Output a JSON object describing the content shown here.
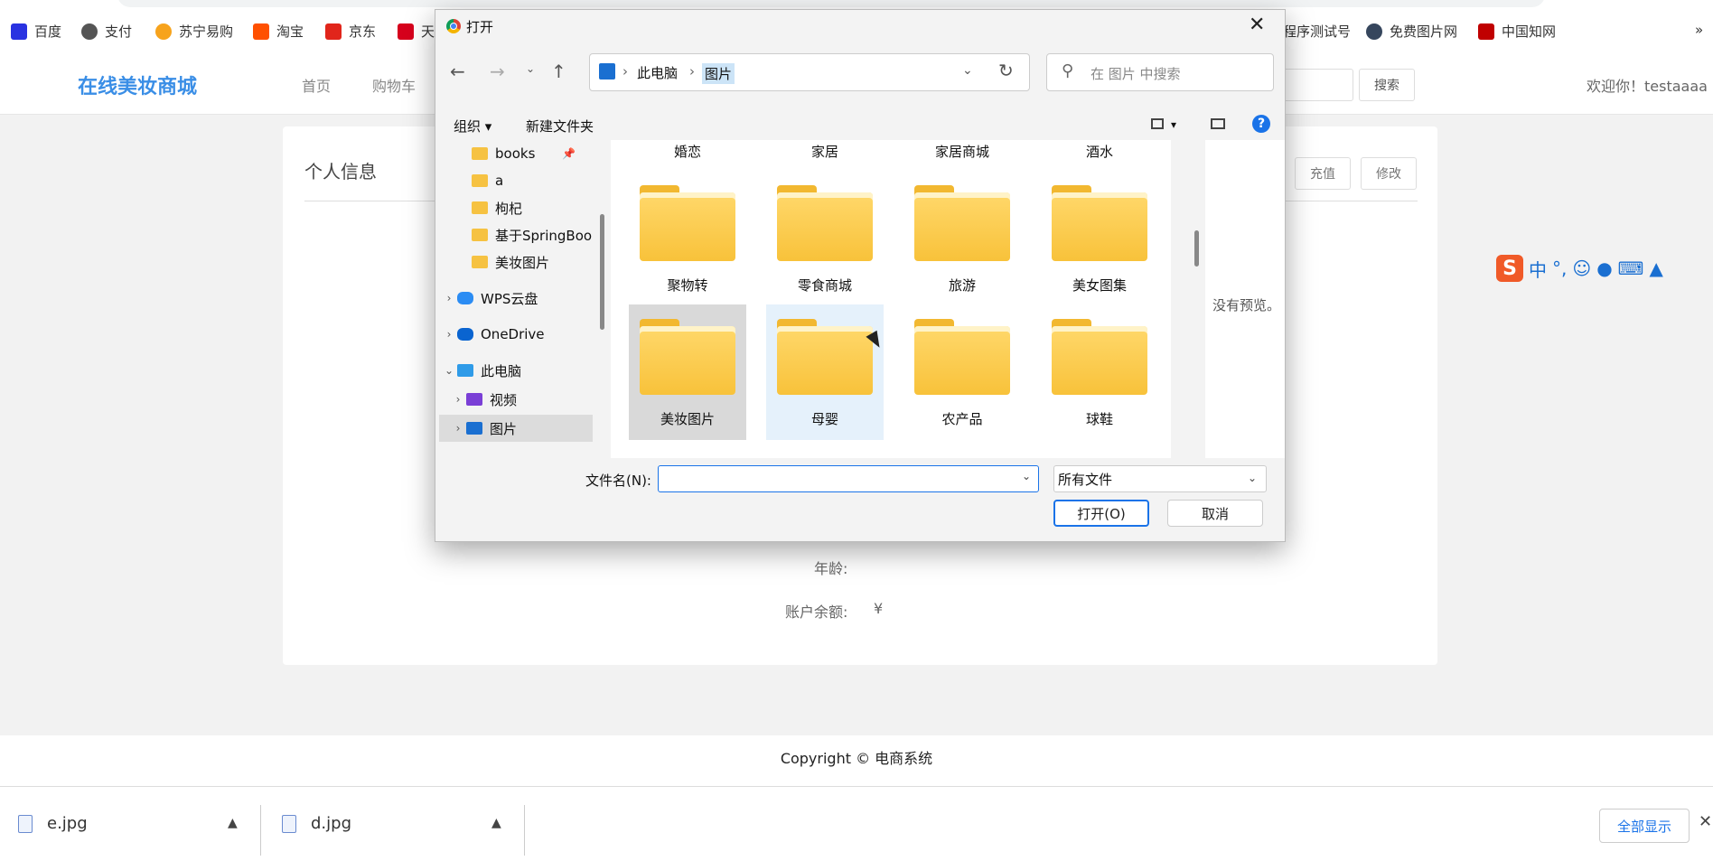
{
  "bookmarks": [
    {
      "label": "百度",
      "icon": "baidu-icon",
      "color": "#2932e1"
    },
    {
      "label": "支付",
      "icon": "globe-icon",
      "color": "#555555"
    },
    {
      "label": "苏宁易购",
      "icon": "suning-icon",
      "color": "#f7a31c"
    },
    {
      "label": "淘宝",
      "icon": "taobao-icon",
      "color": "#ff5000"
    },
    {
      "label": "京东",
      "icon": "jd-icon",
      "color": "#e1251b"
    },
    {
      "label": "天",
      "icon": "tmall-icon",
      "color": "#d6001c"
    },
    {
      "label": "程序测试号",
      "icon": "",
      "color": ""
    },
    {
      "label": "免费图片网",
      "icon": "tumblr-icon",
      "color": "#36465d"
    },
    {
      "label": "中国知网",
      "icon": "cnki-icon",
      "color": "#c00000"
    }
  ],
  "site": {
    "logo": "在线美妆商城",
    "nav": [
      "首页",
      "购物车"
    ],
    "search_button": "搜索",
    "welcome": "欢迎你！testaaaa"
  },
  "card": {
    "title": "个人信息",
    "recharge_button": "充值",
    "edit_button": "修改",
    "age_label": "年龄:",
    "balance_label": "账户余额:",
    "balance_currency": "¥"
  },
  "footer": {
    "copyright": "Copyright © 电商系统"
  },
  "downloads": {
    "files": [
      "e.jpg",
      "d.jpg"
    ],
    "show_all": "全部显示"
  },
  "ime": {
    "logo": "S",
    "mode": "中",
    "punct": "°,"
  },
  "dialog": {
    "title": "打开",
    "path": [
      "此电脑",
      "图片"
    ],
    "search_placeholder": "在 图片 中搜索",
    "organize": "组织",
    "new_folder": "新建文件夹",
    "tree": [
      {
        "label": "books",
        "kind": "folder",
        "pinned": true
      },
      {
        "label": "a",
        "kind": "folder"
      },
      {
        "label": "枸杞",
        "kind": "folder"
      },
      {
        "label": "基于SpringBoo",
        "kind": "folder"
      },
      {
        "label": "美妆图片",
        "kind": "folder"
      },
      {
        "label": "WPS云盘",
        "kind": "cloud"
      },
      {
        "label": "OneDrive",
        "kind": "cloud"
      },
      {
        "label": "此电脑",
        "kind": "pc"
      },
      {
        "label": "视频",
        "kind": "video"
      },
      {
        "label": "图片",
        "kind": "pictures",
        "selected": true
      }
    ],
    "folders_row0": [
      "婚恋",
      "家居",
      "家居商城",
      "酒水"
    ],
    "folders_row1": [
      "聚物转",
      "零食商城",
      "旅游",
      "美女图集"
    ],
    "folders_row2": [
      "美妆图片",
      "母婴",
      "农产品",
      "球鞋"
    ],
    "no_preview": "没有预览。",
    "filename_label": "文件名(N):",
    "filename_value": "",
    "filetype": "所有文件",
    "open_button": "打开(O)",
    "cancel_button": "取消"
  }
}
